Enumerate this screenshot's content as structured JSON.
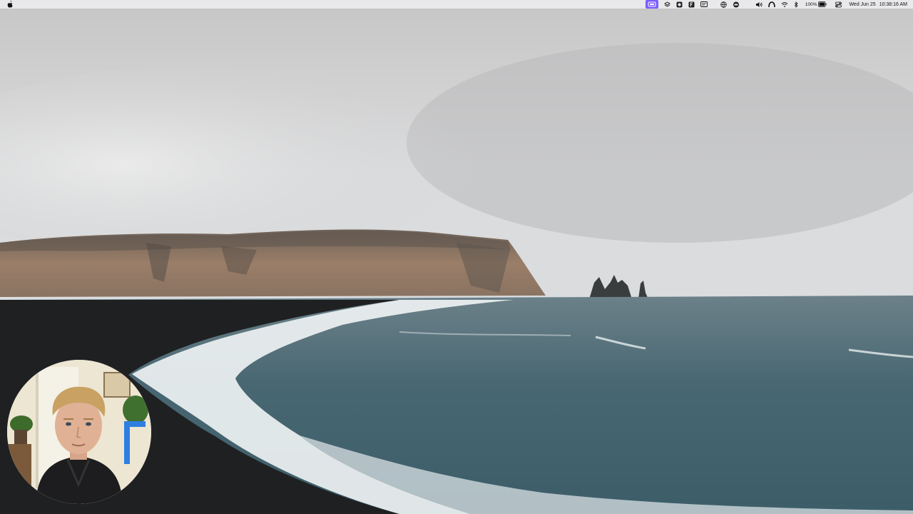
{
  "menubar": {
    "apple_icon": "apple-logo-icon",
    "status_icons": [
      "screen-share-icon",
      "layers-icon",
      "camera-app-icon",
      "f-app-icon",
      "display-icon",
      "globe-icon",
      "privacy-icon",
      "arc-icon",
      "volume-icon"
    ],
    "battery_percent": "100%",
    "wifi_icon": "wifi-icon",
    "bluetooth_icon": "bluetooth-icon",
    "battery_icon": "battery-icon",
    "control_center_icon": "control-center-icon",
    "date": "Wed Jun 25",
    "time": "10:38:16 AM",
    "active_color": "#7b5cff"
  },
  "desktop": {
    "wallpaper": "coastal-cliffs-black-sand-beach"
  },
  "webcam": {
    "label": "webcam-overlay"
  }
}
